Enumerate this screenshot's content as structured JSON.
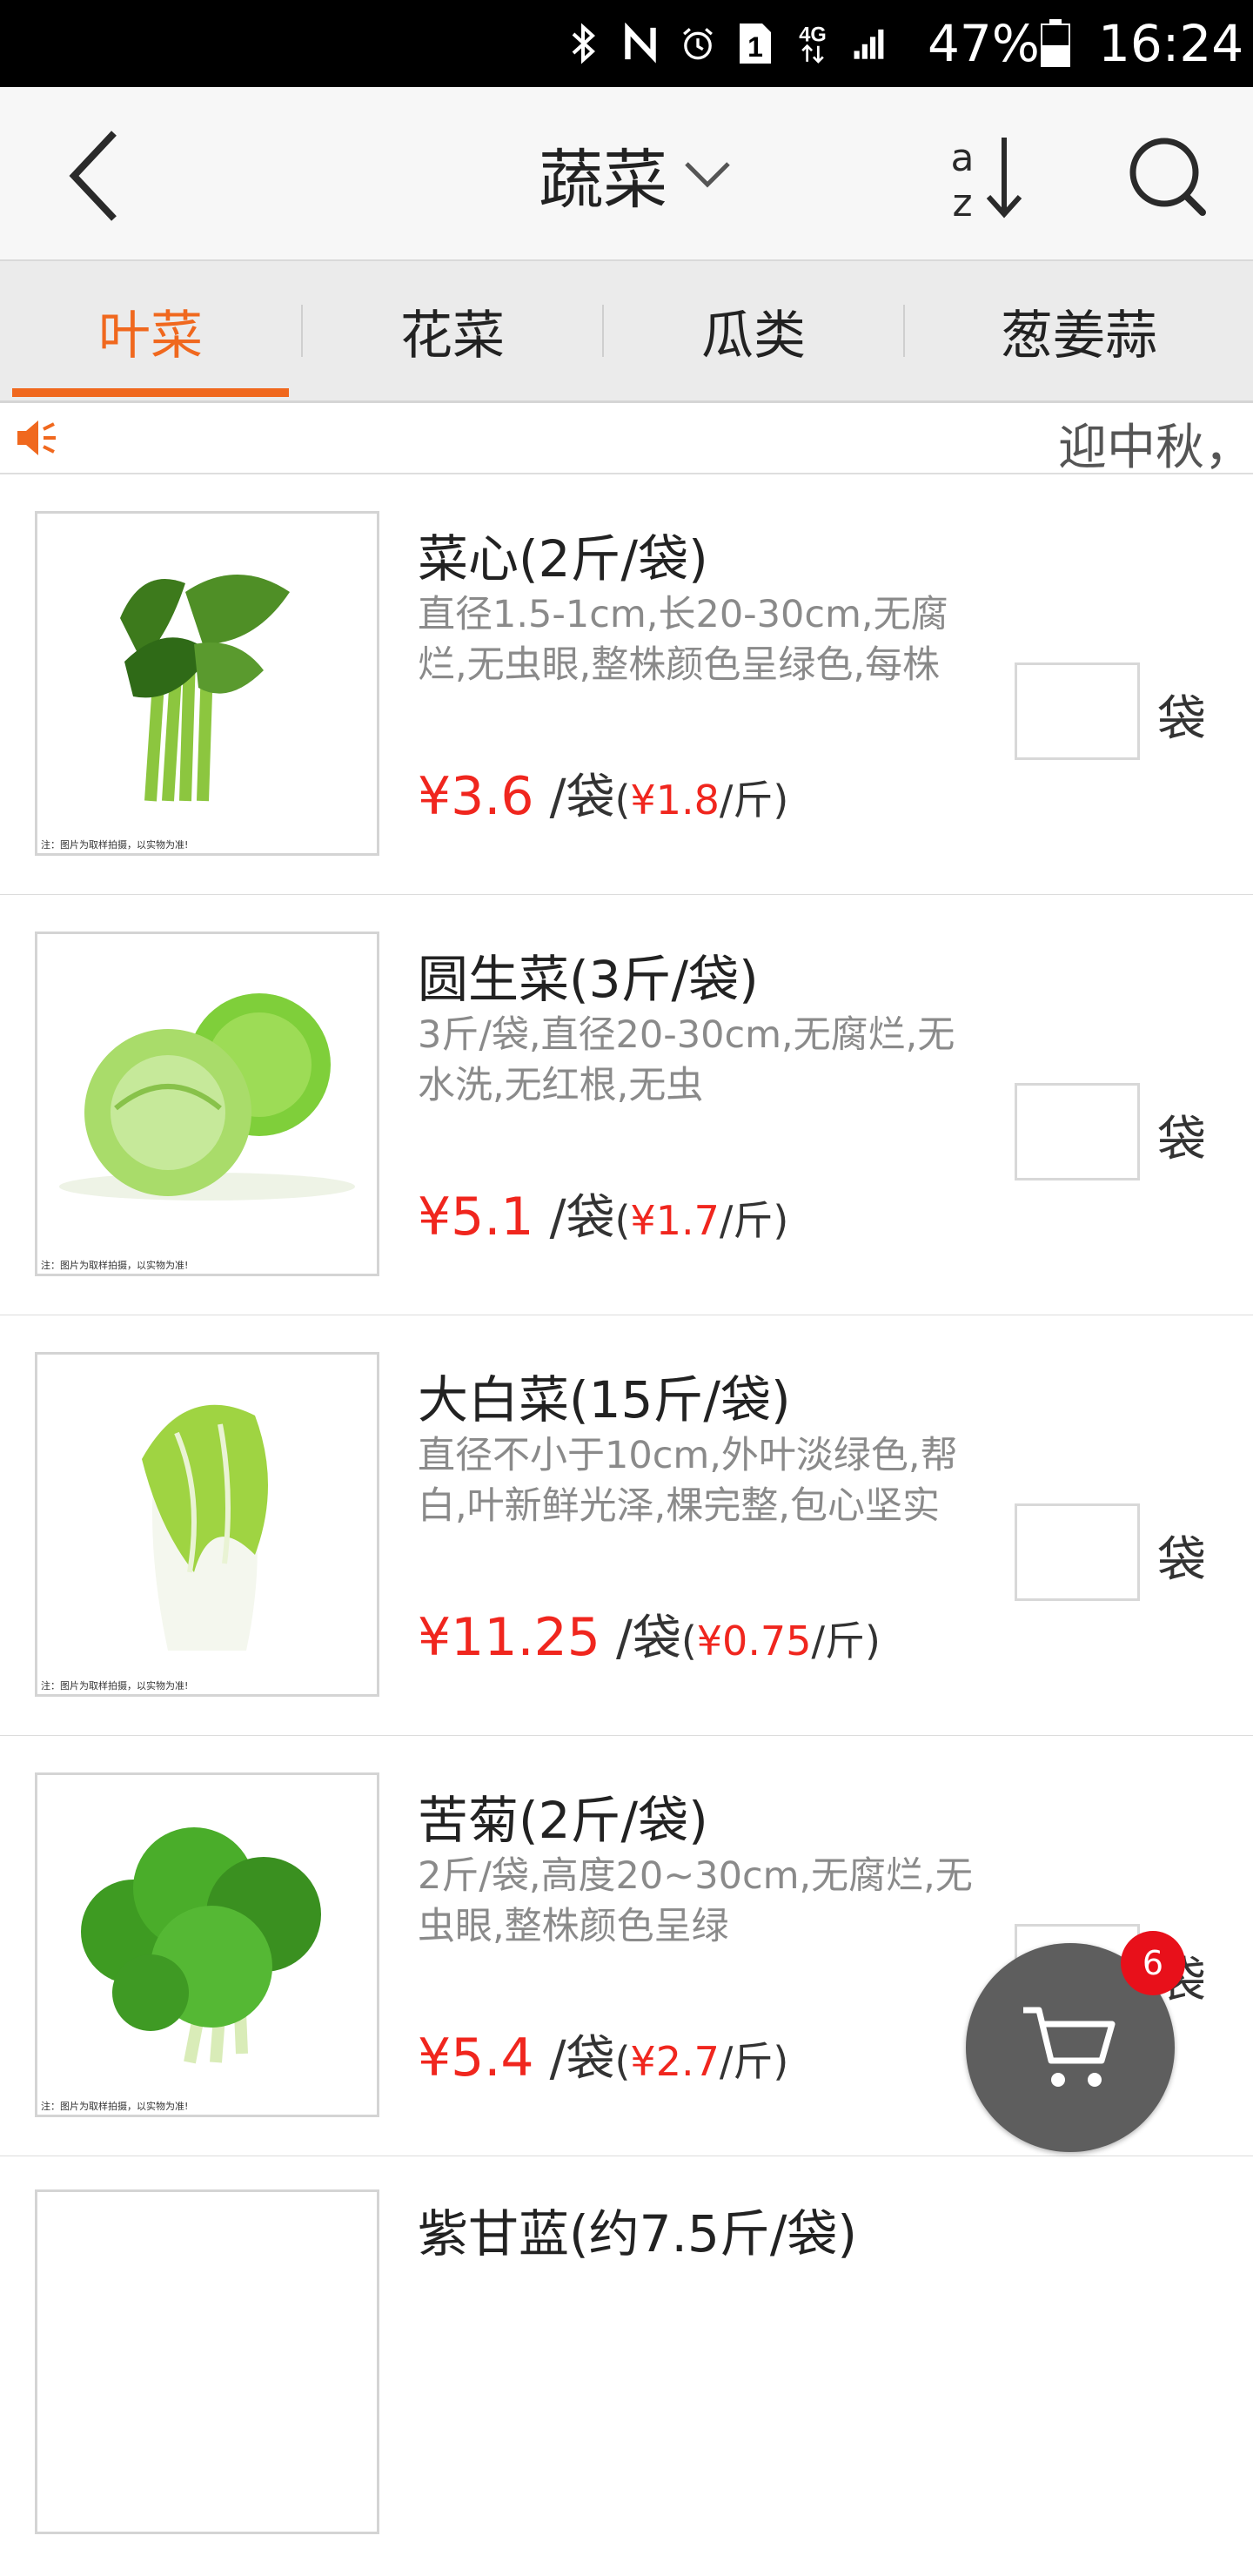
{
  "status_bar": {
    "battery": "47%",
    "time": "16:24",
    "network": "4G",
    "sim": "1",
    "icons": [
      "bluetooth-icon",
      "nfc-icon",
      "alarm-icon",
      "sim-icon",
      "4g-icon",
      "signal-icon",
      "battery-icon"
    ]
  },
  "header": {
    "title": "蔬菜",
    "back_icon": "chevron-left-icon",
    "title_dropdown_icon": "chevron-down-icon",
    "sort_icon": "sort-az-icon",
    "search_icon": "search-icon"
  },
  "tabs": [
    {
      "label": "叶菜",
      "active": true
    },
    {
      "label": "花菜",
      "active": false
    },
    {
      "label": "瓜类",
      "active": false
    },
    {
      "label": "葱姜蒜",
      "active": false
    }
  ],
  "notice": {
    "icon": "speaker-icon",
    "text": "迎中秋，"
  },
  "products": [
    {
      "name": "菜心(2斤/袋)",
      "desc": "直径1.5-1cm,长20-30cm,无腐烂,无虫眼,整株颜色呈绿色,每株",
      "price": "¥3.6",
      "unit": "/袋",
      "sub_price": "¥1.8",
      "sub_unit": "/斤",
      "qty_unit": "袋",
      "image_note": "注：图片为取样拍摄，以实物为准!"
    },
    {
      "name": "圆生菜(3斤/袋)",
      "desc": "3斤/袋,直径20-30cm,无腐烂,无水洗,无红根,无虫",
      "price": "¥5.1",
      "unit": "/袋",
      "sub_price": "¥1.7",
      "sub_unit": "/斤",
      "qty_unit": "袋",
      "image_note": "注：图片为取样拍摄，以实物为准!"
    },
    {
      "name": "大白菜(15斤/袋)",
      "desc": "直径不小于10cm,外叶淡绿色,帮白,叶新鲜光泽,棵完整,包心坚实",
      "price": "¥11.25",
      "unit": "/袋",
      "sub_price": "¥0.75",
      "sub_unit": "/斤",
      "qty_unit": "袋",
      "image_note": "注：图片为取样拍摄，以实物为准!"
    },
    {
      "name": "苦菊(2斤/袋)",
      "desc": "2斤/袋,高度20~30cm,无腐烂,无虫眼,整株颜色呈绿",
      "price": "¥5.4",
      "unit": "/袋",
      "sub_price": "¥2.7",
      "sub_unit": "/斤",
      "qty_unit": "袋",
      "image_note": "注：图片为取样拍摄，以实物为准!"
    },
    {
      "name": "紫甘蓝(约7.5斤/袋)"
    }
  ],
  "cart": {
    "icon": "cart-icon",
    "badge": "6"
  },
  "colors": {
    "accent": "#f0681e",
    "price": "#f0261e",
    "badge": "#e8101a",
    "cart_button": "#5e5e5e"
  }
}
